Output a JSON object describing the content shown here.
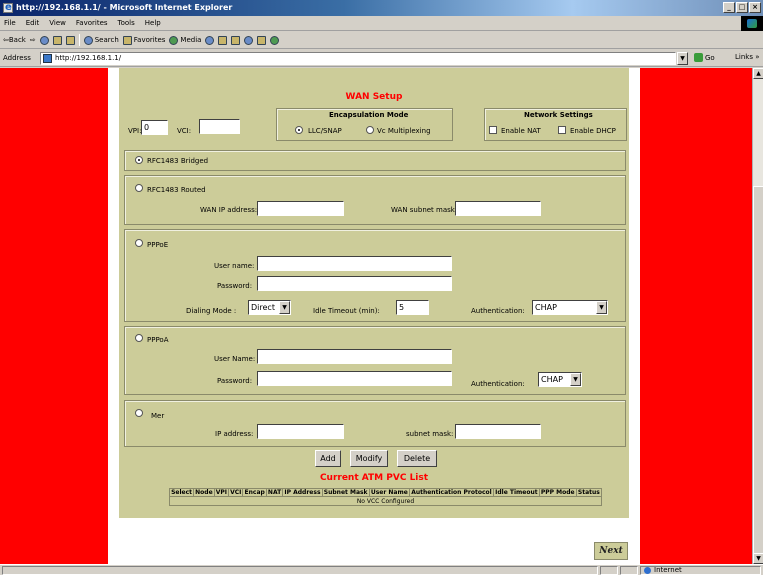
{
  "window": {
    "title": "http://192.168.1.1/ - Microsoft Internet Explorer",
    "min": "_",
    "max": "□",
    "close": "×"
  },
  "menu": [
    "File",
    "Edit",
    "View",
    "Favorites",
    "Tools",
    "Help"
  ],
  "toolbar": {
    "back": "⇦Back",
    "forward": "⇨",
    "search": "Search",
    "favorites": "Favorites",
    "media": "Media"
  },
  "address": {
    "label": "Address",
    "url": "http://192.168.1.1/",
    "go": "Go",
    "links": "Links »"
  },
  "wan_setup": {
    "title": "WAN Setup",
    "vpi_label": "VPI:",
    "vpi_value": "0",
    "vci_label": "VCI:",
    "vci_value": "",
    "encap_title": "Encapsulation Mode",
    "encap_llc": "LLC/SNAP",
    "encap_vc": "Vc Multiplexing",
    "netset_title": "Network Settings",
    "enable_nat": "Enable NAT",
    "enable_dhcp": "Enable DHCP",
    "rfc_bridged": "RFC1483 Bridged",
    "rfc_routed": "RFC1483 Routed",
    "wan_ip_label": "WAN IP address:",
    "wan_mask_label": "WAN subnet mask:",
    "pppoe": "PPPoE",
    "user_name_label": "User name:",
    "password_label": "Password:",
    "dialing_label": "Dialing Mode :",
    "dialing_value": "Direct",
    "idle_label": "Idle Timeout (min):",
    "idle_value": "5",
    "auth_label": "Authentication:",
    "auth_value": "CHAP",
    "pppoa": "PPPoA",
    "pppoa_user_label": "User Name:",
    "pppoa_pass_label": "Password:",
    "pppoa_auth_label": "Authentication:",
    "pppoa_auth_value": "CHAP",
    "mer": "Mer",
    "mer_ip_label": "IP address:",
    "mer_mask_label": "subnet mask:",
    "add": "Add",
    "modify": "Modify",
    "delete": "Delete"
  },
  "atm_list": {
    "title": "Current ATM PVC List",
    "columns": [
      "Select",
      "Node",
      "VPI",
      "VCI",
      "Encap",
      "NAT",
      "IP Address",
      "Subnet Mask",
      "User Name",
      "Authentication Protocol",
      "Idle Timeout",
      "PPP Mode",
      "Status"
    ],
    "empty": "No VCC Configured"
  },
  "next": "Next",
  "status": {
    "zone": "Internet"
  }
}
